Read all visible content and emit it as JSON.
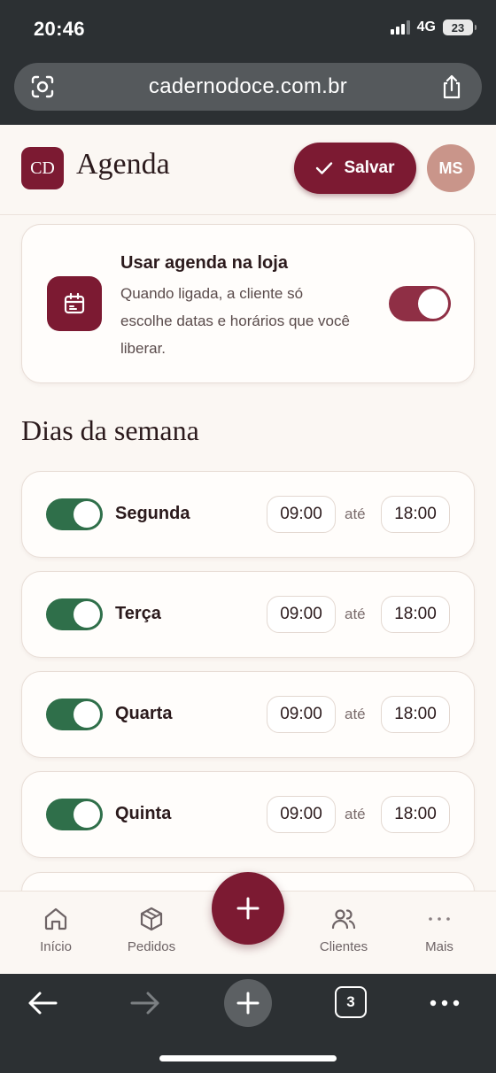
{
  "status": {
    "time": "20:46",
    "network": "4G",
    "battery": "23"
  },
  "browser": {
    "url": "cadernodoce.com.br",
    "tab_count": "3"
  },
  "header": {
    "logo": "CD",
    "title": "Agenda",
    "save_label": "Salvar",
    "avatar_initials": "MS",
    "accent_color": "#7c1a32"
  },
  "store_agenda": {
    "title": "Usar agenda na loja",
    "description": "Quando ligada, a cliente só escolhe datas e horários que você liberar.",
    "enabled": true
  },
  "weekdays": {
    "section_title": "Dias da semana",
    "separator": "até",
    "days": [
      {
        "name": "Segunda",
        "enabled": true,
        "start": "09:00",
        "end": "18:00"
      },
      {
        "name": "Terça",
        "enabled": true,
        "start": "09:00",
        "end": "18:00"
      },
      {
        "name": "Quarta",
        "enabled": true,
        "start": "09:00",
        "end": "18:00"
      },
      {
        "name": "Quinta",
        "enabled": true,
        "start": "09:00",
        "end": "18:00"
      }
    ]
  },
  "bottom_nav": {
    "items": [
      {
        "label": "Início",
        "icon": "home-icon"
      },
      {
        "label": "Pedidos",
        "icon": "box-icon"
      },
      {
        "label": "Clientes",
        "icon": "users-icon"
      },
      {
        "label": "Mais",
        "icon": "more-icon"
      }
    ],
    "fab_icon": "plus-icon"
  }
}
